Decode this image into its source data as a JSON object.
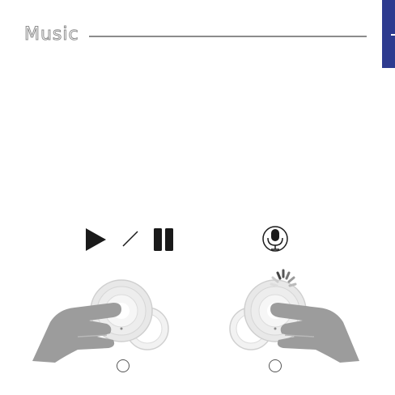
{
  "header": {
    "title": "Music"
  },
  "colors": {
    "accent_tab": "#2e3b8f",
    "ink": "#1a1a1a",
    "earbud_light": "#e6e6e6",
    "hand": "#9a9a9a"
  },
  "panels": [
    {
      "gesture_icons": [
        "play-icon",
        "slash-icon",
        "pause-icon"
      ]
    },
    {
      "gesture_icons": [
        "microphone-icon",
        "loading-spinner-icon"
      ]
    }
  ]
}
